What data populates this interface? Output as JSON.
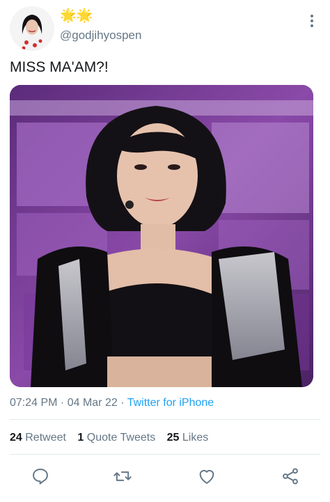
{
  "tweet": {
    "display_name": "🌟🌟",
    "handle": "@godjihyospen",
    "text": "MISS MA'AM?!",
    "time": "07:24 PM",
    "date": "04 Mar 22",
    "separator": " · ",
    "source": "Twitter for iPhone",
    "stats": {
      "retweets_count": "24",
      "retweets_label": "Retweet",
      "quotes_count": "1",
      "quotes_label": "Quote Tweets",
      "likes_count": "25",
      "likes_label": "Likes"
    }
  },
  "icons": {
    "more": "more-vertical-icon",
    "reply": "reply-icon",
    "retweet": "retweet-icon",
    "like": "heart-icon",
    "share": "share-icon"
  },
  "colors": {
    "text": "#14171a",
    "secondary": "#657786",
    "link": "#1da1f2",
    "divider": "#e1e8ed",
    "stage_purple": "#7a3a9c"
  }
}
